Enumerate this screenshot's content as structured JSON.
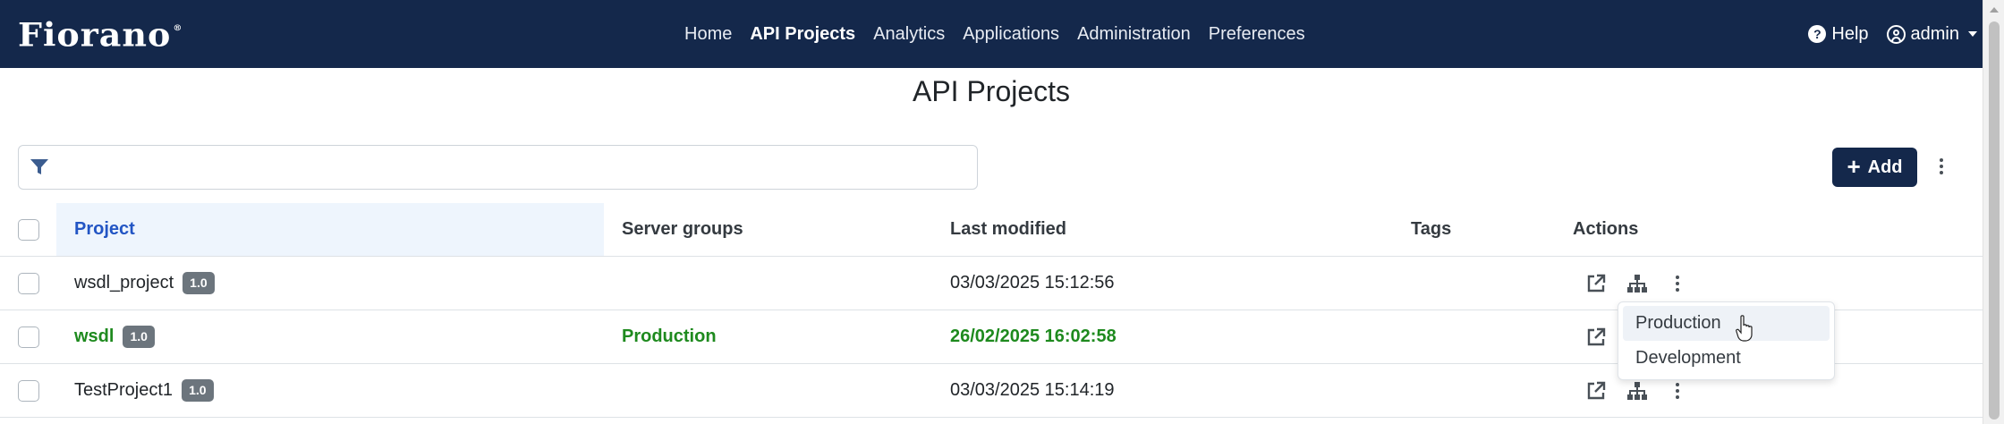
{
  "brand": {
    "logo_text": "Fiorano",
    "logo_mark": "®"
  },
  "nav": {
    "links": [
      "Home",
      "API Projects",
      "Analytics",
      "Applications",
      "Administration",
      "Preferences"
    ],
    "active": "API Projects",
    "help_label": "Help",
    "help_glyph": "?",
    "user_label": "admin"
  },
  "page": {
    "title": "API Projects"
  },
  "toolbar": {
    "filter_value": "",
    "add_label": "Add",
    "add_glyph": "+"
  },
  "table": {
    "headers": {
      "project": "Project",
      "server_groups": "Server groups",
      "last_modified": "Last modified",
      "tags": "Tags",
      "actions": "Actions"
    },
    "rows": [
      {
        "project": "wsdl_project",
        "version": "1.0",
        "server_groups": "",
        "last_modified": "03/03/2025 15:12:56",
        "tags": "",
        "highlight": false
      },
      {
        "project": "wsdl",
        "version": "1.0",
        "server_groups": "Production",
        "last_modified": "26/02/2025 16:02:58",
        "tags": "",
        "highlight": true
      },
      {
        "project": "TestProject1",
        "version": "1.0",
        "server_groups": "",
        "last_modified": "03/03/2025 15:14:19",
        "tags": "",
        "highlight": false
      }
    ]
  },
  "dropdown": {
    "items": [
      "Production",
      "Development"
    ],
    "hovered": "Production"
  },
  "colors": {
    "navbar": "#14284b",
    "accent_green": "#1e8a1e",
    "header_project": "#2255c4",
    "badge": "#6c757d"
  },
  "icons": [
    "filter-icon",
    "help-icon",
    "user-icon",
    "open-external-icon",
    "sitemap-icon",
    "kebab-icon",
    "hand-cursor-icon"
  ]
}
